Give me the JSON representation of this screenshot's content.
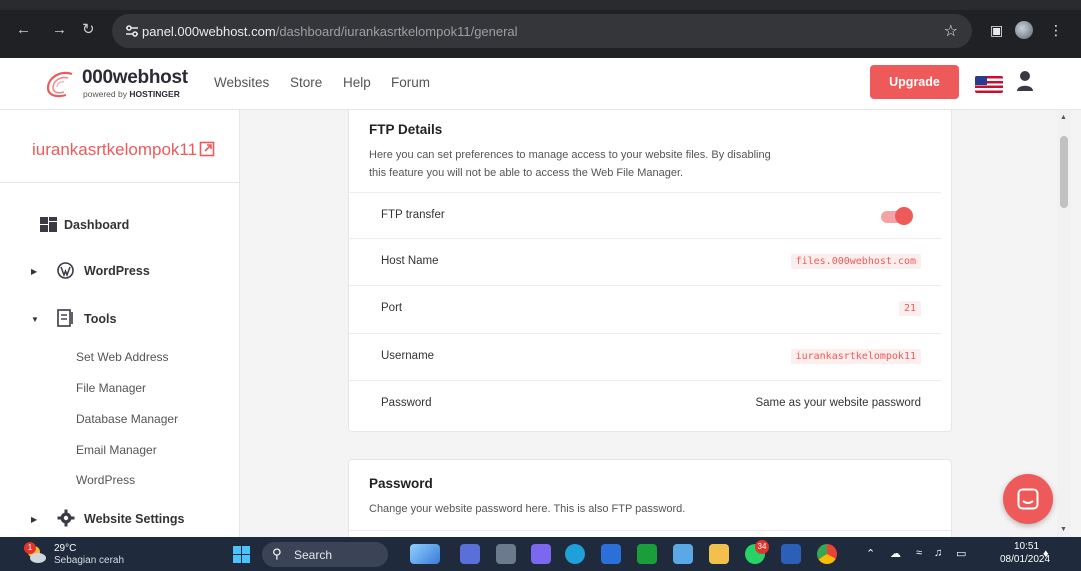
{
  "browser": {
    "url_host": "panel.000webhost.com",
    "url_path": "/dashboard/iurankasrtkelompok11/general"
  },
  "header": {
    "logo_text": "000webhost",
    "logo_sub_prefix": "powered by ",
    "logo_sub_brand": "HOSTINGER",
    "nav": [
      "Websites",
      "Store",
      "Help",
      "Forum"
    ],
    "upgrade_label": "Upgrade"
  },
  "sidebar": {
    "site_name": "iurankasrtkelompok11",
    "items": [
      {
        "label": "Dashboard",
        "icon": "dashboard-icon"
      },
      {
        "label": "WordPress",
        "icon": "wordpress-icon"
      },
      {
        "label": "Tools",
        "icon": "tools-icon"
      },
      {
        "label": "Website Settings",
        "icon": "settings-gear-icon"
      }
    ],
    "tools_sub": [
      "Set Web Address",
      "File Manager",
      "Database Manager",
      "Email Manager",
      "WordPress"
    ]
  },
  "ftp": {
    "title": "FTP Details",
    "description_line1": "Here you can set preferences to manage access to your website files. By disabling",
    "description_line2": "this feature you will not be able to access the Web File Manager.",
    "transfer_label": "FTP transfer",
    "transfer_enabled": true,
    "host_label": "Host Name",
    "host_value": "files.000webhost.com",
    "port_label": "Port",
    "port_value": "21",
    "username_label": "Username",
    "username_value": "iurankasrtkelompok11",
    "password_label": "Password",
    "password_value": "Same as your website password"
  },
  "password_card": {
    "title": "Password",
    "description": "Change your website password here. This is also FTP password."
  },
  "taskbar": {
    "weather_badge": "1",
    "temp": "29°C",
    "weather_desc": "Sebagian cerah",
    "search_label": "Search",
    "whatsapp_badge": "34",
    "time": "10:51",
    "date": "08/01/2024"
  },
  "colors": {
    "accent": "#ee5a5a",
    "taskbar": "#1f2a3c",
    "browser": "#202124"
  }
}
